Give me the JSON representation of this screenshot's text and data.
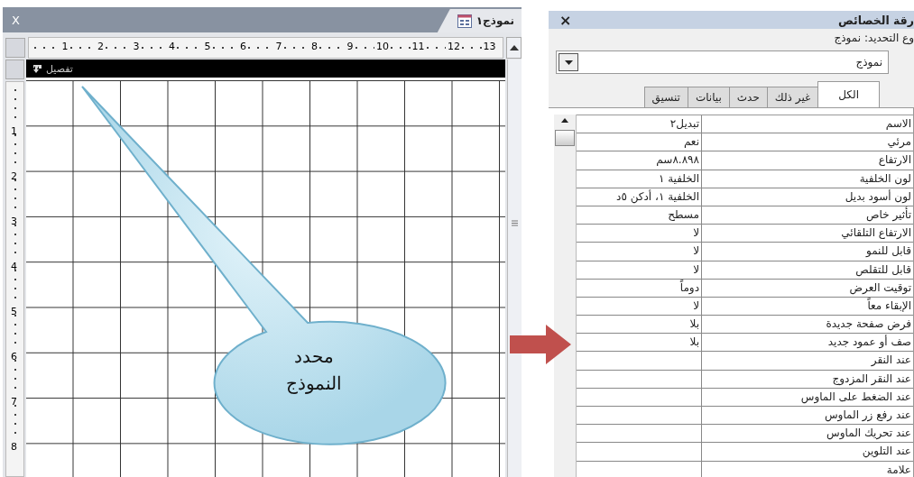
{
  "form_window": {
    "close_glyph": "X",
    "tab": {
      "title": "نموذج١",
      "selected": true
    },
    "ruler_h": [
      "13",
      "12",
      "11",
      "10",
      "9",
      "8",
      "7",
      "6",
      "5",
      "4",
      "3",
      "2",
      "1"
    ],
    "ruler_v": [
      "1",
      "2",
      "3",
      "4",
      "5",
      "6",
      "7",
      "8"
    ],
    "section_bar": {
      "label": "تفصيل"
    }
  },
  "callout": {
    "text": "محدد\nالنموذج"
  },
  "property_sheet": {
    "title": "رقة الخصائص",
    "close_glyph": "×",
    "selection_type": "وع التحديد:  نموذج",
    "dropdown": {
      "value": "نموذج"
    },
    "tabs": [
      {
        "label": "الكل",
        "selected": true
      },
      {
        "label": "غير ذلك",
        "selected": false
      },
      {
        "label": "حدث",
        "selected": false
      },
      {
        "label": "بيانات",
        "selected": false
      },
      {
        "label": "تنسيق",
        "selected": false
      }
    ],
    "rows": [
      {
        "label": "الاسم",
        "value": "تبديل٢"
      },
      {
        "label": "مرئي",
        "value": "نعم"
      },
      {
        "label": "الارتفاع",
        "value": "٨.٨٩٨سم"
      },
      {
        "label": "لون الخلفية",
        "value": "الخلفية ١"
      },
      {
        "label": "لون أسود بديل",
        "value": "الخلفية ١، أدكن ٥د"
      },
      {
        "label": "تأثير خاص",
        "value": "مسطح"
      },
      {
        "label": "الارتفاع التلقائي",
        "value": "لا"
      },
      {
        "label": "قابل للنمو",
        "value": "لا"
      },
      {
        "label": "قابل للتقلص",
        "value": "لا"
      },
      {
        "label": "توقيت العرض",
        "value": "دوماً"
      },
      {
        "label": "الإبقاء معاً",
        "value": "لا"
      },
      {
        "label": "فرض صفحة جديدة",
        "value": "بلا"
      },
      {
        "label": "صف أو عمود جديد",
        "value": "بلا"
      },
      {
        "label": "عند النقر"
      },
      {
        "label": "عند النقر المزدوج"
      },
      {
        "label": "عند الضغط على الماوس"
      },
      {
        "label": "عند رفع زر الماوس"
      },
      {
        "label": "عند تحريك الماوس"
      },
      {
        "label": "عند التلوين"
      },
      {
        "label": "علامة"
      }
    ]
  }
}
